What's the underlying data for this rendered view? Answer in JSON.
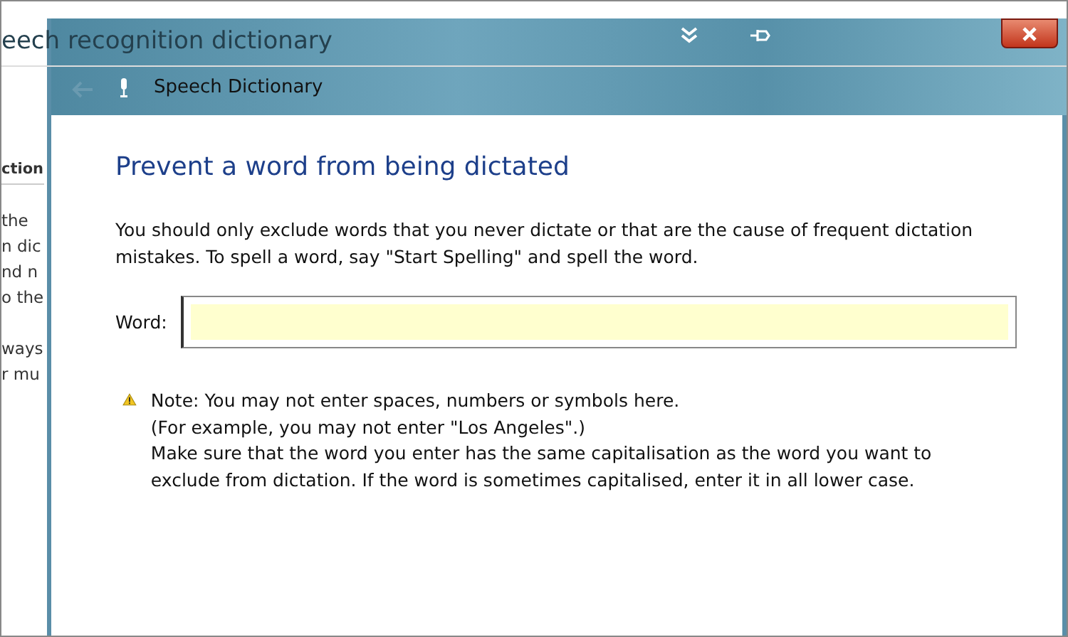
{
  "background_window": {
    "title": "eech recognition dictionary",
    "column_header": "ction",
    "paragraphs": [
      [
        "the",
        "n dic",
        "nd n",
        "o the"
      ],
      [
        "ways",
        "r mu"
      ]
    ]
  },
  "dialog": {
    "title": "Speech Dictionary",
    "heading": "Prevent a word from being dictated",
    "description": "You should only exclude words that you never dictate or that are the cause of frequent dictation mistakes. To spell a word, say \"Start Spelling\" and spell the word.",
    "word_field": {
      "label": "Word:"
    },
    "note": [
      "Note: You may not enter spaces, numbers or symbols here.",
      "(For example, you may not enter \"Los Angeles\".)",
      "Make sure that the word you enter has the same capitalisation as the word you want to exclude from dictation. If the word is sometimes capitalised, enter it in all lower case."
    ]
  }
}
